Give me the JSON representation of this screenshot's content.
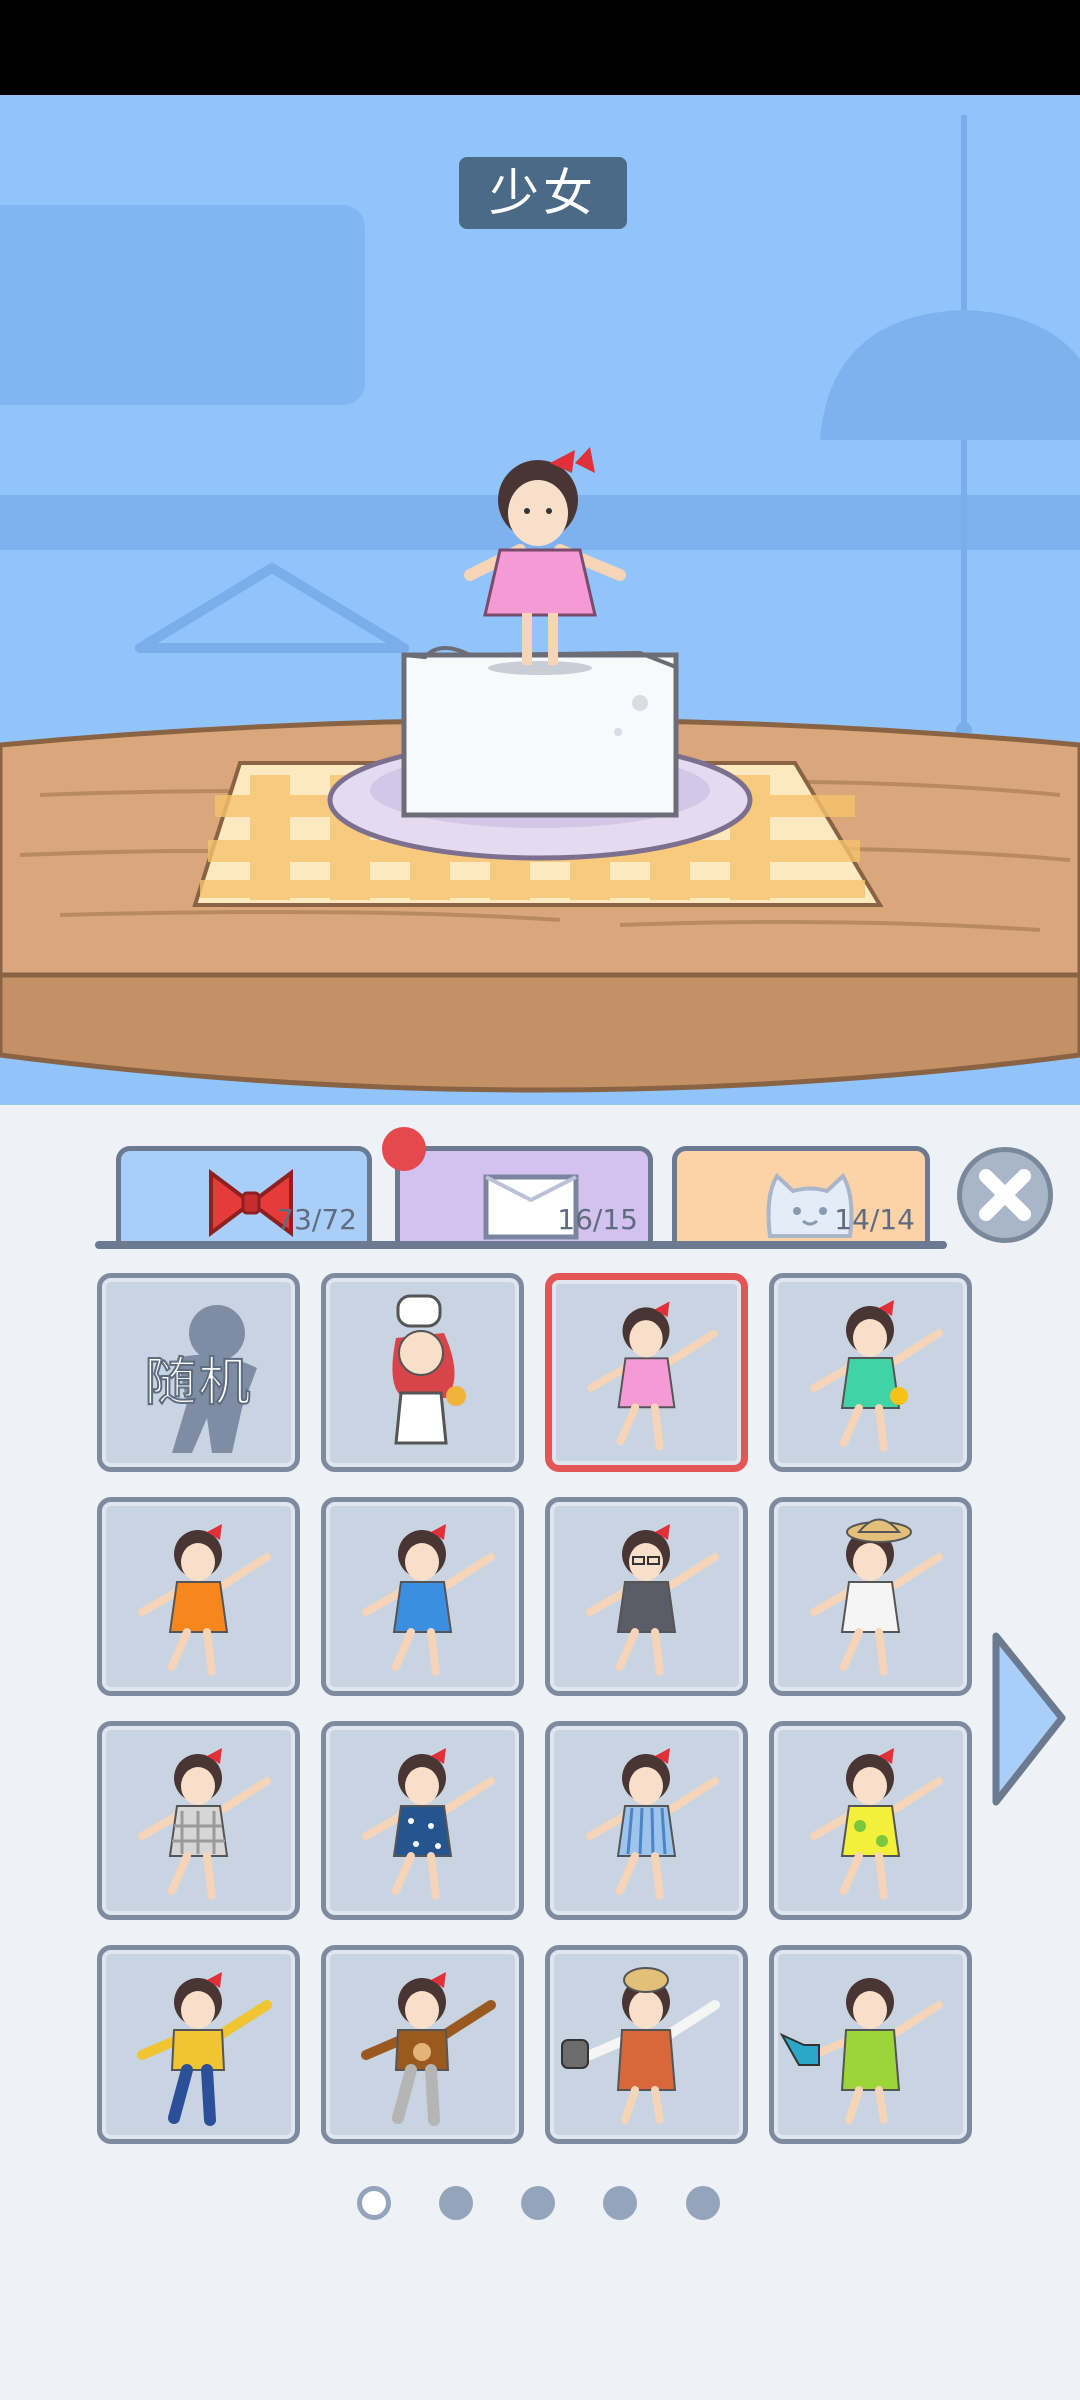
{
  "scene": {
    "title": "少女"
  },
  "tabs": [
    {
      "id": "outfits",
      "icon": "bow-icon",
      "count": "73/72"
    },
    {
      "id": "pedestals",
      "icon": "tofu-block-icon",
      "count": "16/15",
      "has_notification": true
    },
    {
      "id": "pets",
      "icon": "cat-icon",
      "count": "14/14"
    }
  ],
  "grid": {
    "random_label": "随机",
    "items": [
      {
        "type": "random"
      },
      {
        "type": "chef"
      },
      {
        "type": "pink-dress",
        "selected": true
      },
      {
        "type": "green-dress"
      },
      {
        "type": "orange-dress"
      },
      {
        "type": "blue-dress"
      },
      {
        "type": "gray-dress-glasses"
      },
      {
        "type": "white-dress-straw-hat"
      },
      {
        "type": "checkered-dress"
      },
      {
        "type": "polka-dot-dress"
      },
      {
        "type": "striped-dress"
      },
      {
        "type": "yellow-floral-dress"
      },
      {
        "type": "yellow-hoodie"
      },
      {
        "type": "bear-sweater"
      },
      {
        "type": "apron-with-kettle"
      },
      {
        "type": "green-apron-watering-can"
      }
    ]
  },
  "pagination": {
    "pages": 5,
    "current": 1
  },
  "colors": {
    "sky": "#90c4fa",
    "table": "#d9a77b",
    "panel": "#eef1f6",
    "selected_border": "#e45656"
  }
}
